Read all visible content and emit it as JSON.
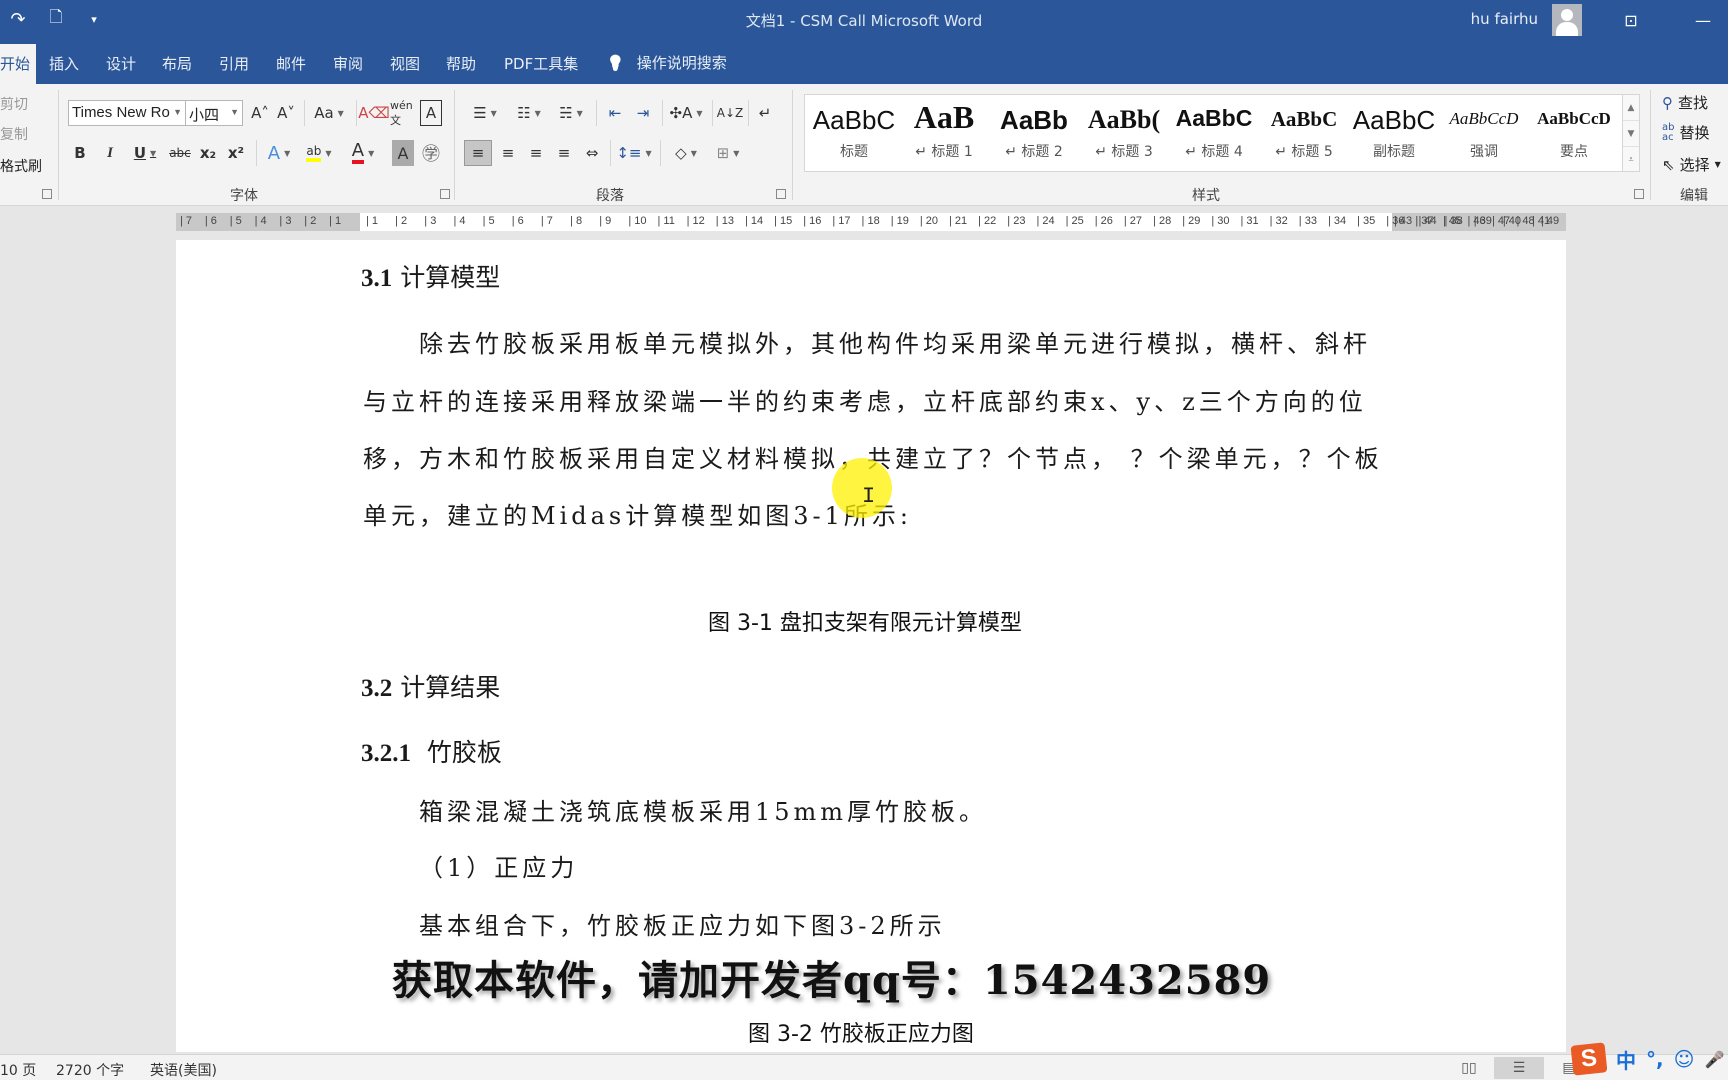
{
  "titlebar": {
    "doc_title": "文档1  -  CSM Call Microsoft Word",
    "user_name": "hu fairhu",
    "icons": [
      "redo-icon",
      "new-document-icon",
      "customize-qat-icon",
      "ribbon-display-options-icon",
      "minimize-icon"
    ],
    "qat_redo": "↷",
    "qat_new": "🗋",
    "qat_customize": "▾",
    "ribbon_display": "⊡",
    "minimize": "—"
  },
  "ribbon_tabs": {
    "items": [
      {
        "label": "开始",
        "active": true
      },
      {
        "label": "插入"
      },
      {
        "label": "设计"
      },
      {
        "label": "布局"
      },
      {
        "label": "引用"
      },
      {
        "label": "邮件"
      },
      {
        "label": "审阅"
      },
      {
        "label": "视图"
      },
      {
        "label": "帮助"
      },
      {
        "label": "PDF工具集"
      }
    ],
    "tell_me": "操作说明搜索",
    "tell_me_icon": "💡"
  },
  "clipboard": {
    "cut": "剪切",
    "copy": "复制",
    "format_painter": "格式刷"
  },
  "font_group": {
    "label": "字体",
    "font_name": "Times New Ro",
    "font_size": "小四",
    "grow": "A˄",
    "shrink": "A˅",
    "change_case": "Aa",
    "clear_format": "A⌫",
    "phonetic": "wén文",
    "char_border": "A",
    "bold": "B",
    "italic": "I",
    "underline": "U",
    "strike": "abc",
    "subscript": "x₂",
    "superscript": "x²",
    "text_effect": "A",
    "highlight": "ab",
    "font_color": "A",
    "char_shading": "A",
    "enclose": "㊫",
    "highlight_color": "#ffff00",
    "font_color_value": "#e81123"
  },
  "paragraph_group": {
    "label": "段落",
    "bullets": "☰",
    "numbering": "☷",
    "multilevel": "☵",
    "decrease_indent": "⇤",
    "increase_indent": "⇥",
    "asian_layout": "✣A",
    "sort": "A↓Z",
    "show_marks": "↵",
    "align_left": "≡",
    "center": "≡",
    "align_right": "≡",
    "justify": "≡",
    "distribute": "⇔",
    "line_spacing": "↕≡",
    "shading": "◇",
    "borders": "⊞"
  },
  "styles_group": {
    "label": "样式",
    "items": [
      {
        "sample": "AaBbC",
        "name": "标题"
      },
      {
        "sample": "AaB",
        "name": "↵ 标题 1"
      },
      {
        "sample": "AaBb",
        "name": "↵ 标题 2"
      },
      {
        "sample": "AaBb(",
        "name": "↵ 标题 3"
      },
      {
        "sample": "AaBbC",
        "name": "↵ 标题 4"
      },
      {
        "sample": "AaBbC",
        "name": "↵ 标题 5"
      },
      {
        "sample": "AaBbC",
        "name": "副标题"
      },
      {
        "sample": "AaBbCcD",
        "name": "强调"
      },
      {
        "sample": "AaBbCcD",
        "name": "要点"
      }
    ]
  },
  "editing_group": {
    "label": "编辑",
    "find": "查找",
    "replace": "替换",
    "select": "选择"
  },
  "ruler": {
    "left_ticks": [
      "7",
      "6",
      "5",
      "4",
      "3",
      "2",
      "1"
    ],
    "ticks": [
      "1",
      "2",
      "3",
      "4",
      "5",
      "6",
      "7",
      "8",
      "9",
      "10",
      "11",
      "12",
      "13",
      "14",
      "15",
      "16",
      "17",
      "18",
      "19",
      "20",
      "21",
      "22",
      "23",
      "24",
      "25",
      "26",
      "27",
      "28",
      "29",
      "30",
      "31",
      "32",
      "33",
      "34",
      "35",
      "36",
      "37",
      "38",
      "39",
      "40",
      "41"
    ],
    "right_ticks": [
      "43",
      "44",
      "45",
      "46",
      "47",
      "48",
      "49"
    ]
  },
  "document": {
    "h_3_1_num": "3.1",
    "h_3_1_text": "计算模型",
    "para1_line1": "除去竹胶板采用板单元模拟外，其他构件均采用梁单元进行模拟，横杆、斜杆",
    "para1_line2": "与立杆的连接采用释放梁端一半的约束考虑，立杆底部约束x、y、z三个方向的位",
    "para1_line3": "移，方木和竹胶板采用自定义材料模拟，共建立了？个节点， ？个梁单元，？个板",
    "para1_line4": "单元，建立的Midas计算模型如图3-1所示:",
    "fig_3_1_caption": "图 3-1 盘扣支架有限元计算模型",
    "h_3_2_num": "3.2",
    "h_3_2_text": "计算结果",
    "h_3_2_1_num": "3.2.1",
    "h_3_2_1_text": "竹胶板",
    "para2": "箱梁混凝土浇筑底模板采用15mm厚竹胶板。",
    "item1": "（1）正应力",
    "para3": "基本组合下，竹胶板正应力如下图3-2所示",
    "fig_3_2_caption": "图 3-2   竹胶板正应力图"
  },
  "overlay": {
    "watermark": "获取本软件，请加开发者qq号：1542432589",
    "cursor_highlight_color": "#fff000"
  },
  "statusbar": {
    "page": "10 页",
    "words": "2720 个字",
    "language": "英语(美国)",
    "ime_logo": "S",
    "ime_mode": "中",
    "ime_punct": "°,",
    "ime_emoji": "☺",
    "ime_voice": "🎤",
    "ime_keyboard": "▦"
  }
}
